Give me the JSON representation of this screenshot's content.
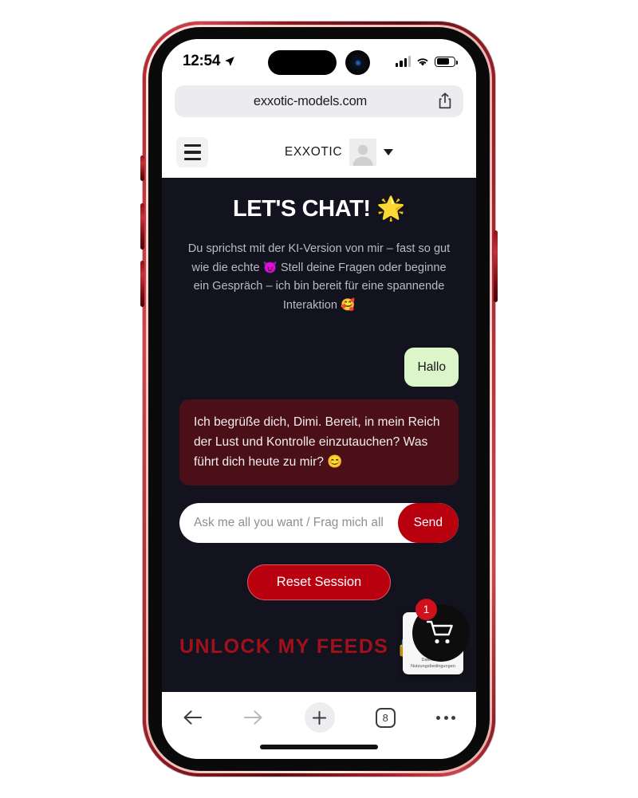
{
  "status_bar": {
    "time": "12:54",
    "location_icon": "location-arrow-icon",
    "signal_icon": "cellular-signal-icon",
    "wifi_icon": "wifi-icon",
    "battery_icon": "battery-icon"
  },
  "browser": {
    "url": "exxotic-models.com",
    "share_icon": "share-icon",
    "toolbar": {
      "back_icon": "back-arrow-icon",
      "forward_icon": "forward-arrow-icon",
      "new_tab_icon": "plus-icon",
      "tab_count": "8",
      "more_icon": "more-dots-icon"
    }
  },
  "site_header": {
    "menu_icon": "hamburger-menu-icon",
    "brand": "EXXOTIC",
    "avatar_icon": "user-avatar-icon",
    "dropdown_icon": "chevron-down-icon"
  },
  "page": {
    "title": "LET'S CHAT! 🌟",
    "intro": "Du sprichst mit der KI-Version von mir – fast so gut wie die echte 😈 Stell deine Fragen oder beginne ein Gespräch – ich bin bereit für eine spannende Interaktion 🥰",
    "messages": [
      {
        "role": "user",
        "text": "Hallo"
      },
      {
        "role": "bot",
        "text": "Ich begrüße dich, Dimi. Bereit, in mein Reich der Lust und Kontrolle einzutauchen? Was führt dich heute zu mir? 😊"
      }
    ],
    "composer": {
      "placeholder": "Ask me all you want / Frag mich alles",
      "value": "",
      "send_label": "Send"
    },
    "reset_label": "Reset Session",
    "unlock_text": "UNLOCK MY FEEDS",
    "unlock_emoji": "🔒",
    "consent_card": {
      "line1": "Datensch…",
      "line2": "Nutzungsbedingungen"
    },
    "cart": {
      "icon": "shopping-cart-icon",
      "badge": "1"
    }
  },
  "colors": {
    "page_bg": "#13131f",
    "accent_red": "#b8000e",
    "bot_bubble": "#4b0f18",
    "user_bubble": "#dcf6c9",
    "unlock_red": "#a1111b",
    "frame_red": "#b3232c"
  }
}
